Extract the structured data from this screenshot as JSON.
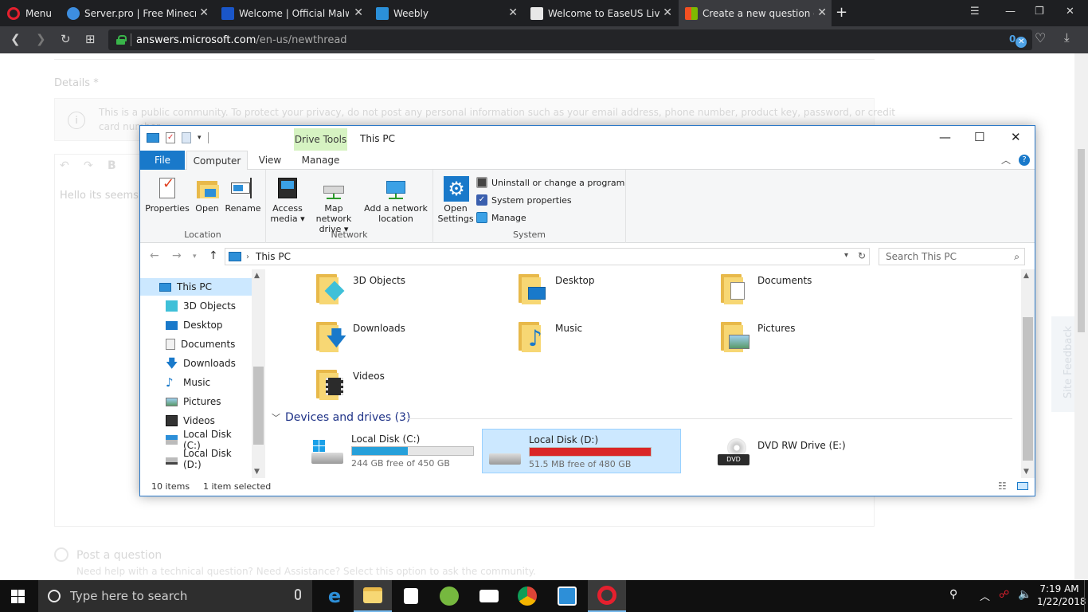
{
  "browser": {
    "menu_label": "Menu",
    "tabs": [
      {
        "title": "Server.pro | Free Minecraft",
        "color": "#3d8ee0"
      },
      {
        "title": "Welcome | Official Malware",
        "color": "#1a56c9"
      },
      {
        "title": "Weebly",
        "color": "#2b90d9"
      },
      {
        "title": "Welcome to EaseUS LiveChat",
        "color": "#e8e8e8"
      },
      {
        "title": "Create a new question or start",
        "color": "#f25022"
      }
    ],
    "url_host": "answers.microsoft.com",
    "url_path": "/en-us/newthread",
    "adblock_count": "0"
  },
  "page": {
    "details_label": "Details *",
    "privacy_notice": "This is a public community. To protect your privacy, do not post any personal information such as your email address, phone number, product key, password, or credit",
    "privacy_notice_2": "card number.",
    "editor_text": "Hello its seems",
    "post_question_label": "Post a question",
    "post_question_desc": "Need help with a technical question? Need Assistance? Select this option to ask the community.",
    "site_feedback": "Site Feedback"
  },
  "explorer": {
    "context_tab": "Drive Tools",
    "title": "This PC",
    "ribbon_tabs": [
      "File",
      "Computer",
      "View",
      "Manage"
    ],
    "location_group": {
      "label": "Location",
      "buttons": [
        "Properties",
        "Open",
        "Rename"
      ]
    },
    "network_group": {
      "label": "Network",
      "buttons": [
        {
          "line1": "Access",
          "line2": "media ▾"
        },
        {
          "line1": "Map network",
          "line2": "drive ▾"
        },
        {
          "line1": "Add a network",
          "line2": "location"
        }
      ]
    },
    "system_group": {
      "label": "System",
      "open_settings": {
        "line1": "Open",
        "line2": "Settings"
      },
      "items": [
        "Uninstall or change a program",
        "System properties",
        "Manage"
      ]
    },
    "address": "This PC",
    "search_placeholder": "Search This PC",
    "nav_items": [
      "This PC",
      "3D Objects",
      "Desktop",
      "Documents",
      "Downloads",
      "Music",
      "Pictures",
      "Videos",
      "Local Disk (C:)",
      "Local Disk (D:)"
    ],
    "folders": [
      "3D Objects",
      "Desktop",
      "Documents",
      "Downloads",
      "Music",
      "Pictures",
      "Videos"
    ],
    "devices_header": "Devices and drives (3)",
    "drives": [
      {
        "name": "Local Disk (C:)",
        "free": "244 GB free of 450 GB",
        "used_fraction": 0.458,
        "bar_color": "#26a0da"
      },
      {
        "name": "Local Disk (D:)",
        "free": "51.5 MB free of 480 GB",
        "used_fraction": 0.9999,
        "bar_color": "#da2626"
      },
      {
        "name": "DVD RW Drive (E:)"
      }
    ],
    "status_items": "10 items",
    "status_selected": "1 item selected"
  },
  "taskbar": {
    "search_placeholder": "Type here to search",
    "time": "7:19 AM",
    "date": "1/22/2018"
  }
}
